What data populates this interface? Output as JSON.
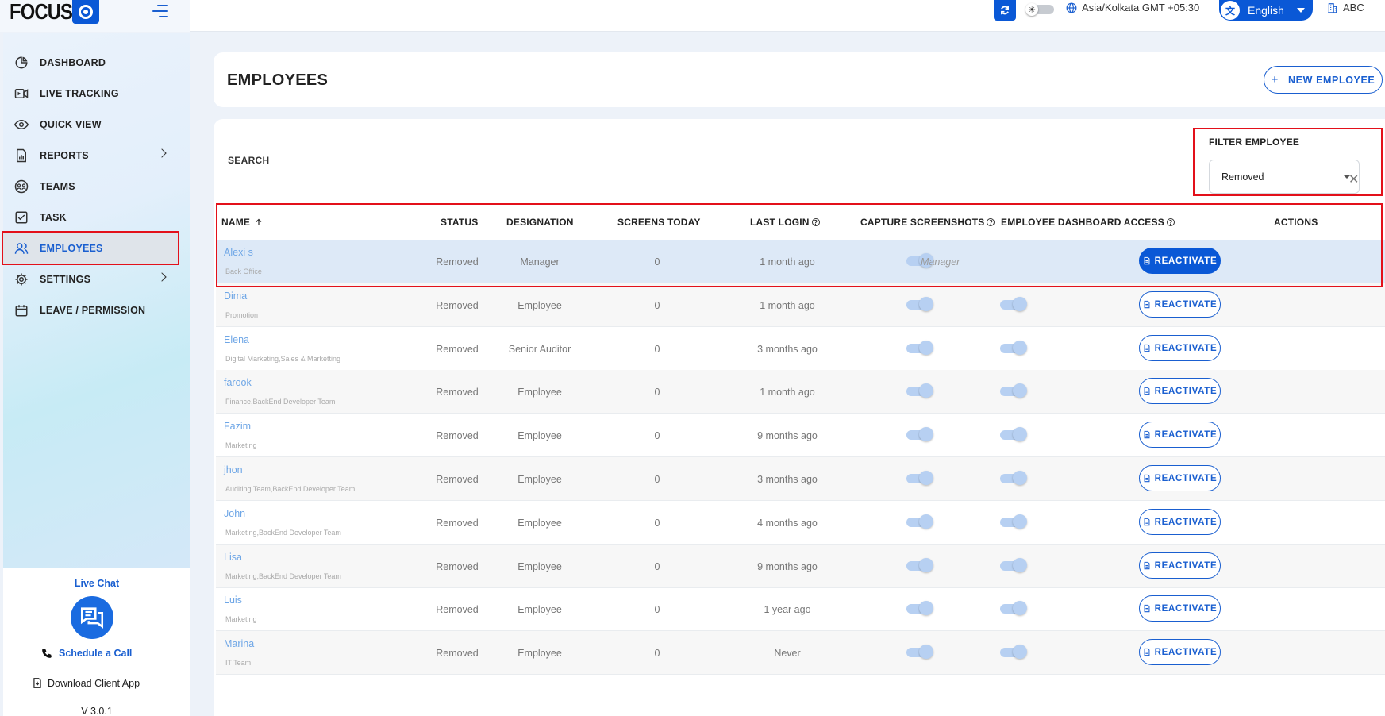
{
  "brand": {
    "logo_text": "FOCUS"
  },
  "topbar": {
    "timezone": "Asia/Kolkata GMT +05:30",
    "language": "English",
    "user": "ABC"
  },
  "sidebar": {
    "items": [
      {
        "label": "DASHBOARD",
        "icon": "pie-chart-icon"
      },
      {
        "label": "LIVE TRACKING",
        "icon": "video-icon"
      },
      {
        "label": "QUICK VIEW",
        "icon": "eye-icon"
      },
      {
        "label": "REPORTS",
        "icon": "report-icon",
        "expandable": true
      },
      {
        "label": "TEAMS",
        "icon": "team-icon"
      },
      {
        "label": "TASK",
        "icon": "task-icon"
      },
      {
        "label": "EMPLOYEES",
        "icon": "users-icon",
        "active": true
      },
      {
        "label": "SETTINGS",
        "icon": "gear-icon",
        "expandable": true
      },
      {
        "label": "LEAVE / PERMISSION",
        "icon": "calendar-icon"
      }
    ],
    "live_chat": "Live Chat",
    "schedule_call": "Schedule a Call",
    "download_app": "Download Client App",
    "version": "V 3.0.1"
  },
  "header": {
    "title": "EMPLOYEES",
    "new_button": "NEW EMPLOYEE"
  },
  "filters": {
    "search_label": "SEARCH",
    "filter_label": "FILTER EMPLOYEE",
    "filter_value": "Removed"
  },
  "table": {
    "columns": {
      "name": "NAME",
      "status": "STATUS",
      "designation": "DESIGNATION",
      "screens_today": "SCREENS TODAY",
      "last_login": "LAST LOGIN",
      "capture": "CAPTURE SCREENSHOTS",
      "dashboard_access": "EMPLOYEE DASHBOARD ACCESS",
      "actions": "ACTIONS"
    },
    "action_label": "REACTIVATE",
    "rows": [
      {
        "name": "Alexi s",
        "team": "Back Office",
        "status": "Removed",
        "designation": "Manager",
        "screens": "0",
        "last_login": "1 month ago",
        "access": "Manager"
      },
      {
        "name": "Dima",
        "team": "Promotion",
        "status": "Removed",
        "designation": "Employee",
        "screens": "0",
        "last_login": "1 month ago"
      },
      {
        "name": "Elena",
        "team": "Digital Marketing,Sales & Marketting",
        "status": "Removed",
        "designation": "Senior Auditor",
        "screens": "0",
        "last_login": "3 months ago"
      },
      {
        "name": "farook",
        "team": "Finance,BackEnd Developer Team",
        "status": "Removed",
        "designation": "Employee",
        "screens": "0",
        "last_login": "1 month ago"
      },
      {
        "name": "Fazim",
        "team": "Marketing",
        "status": "Removed",
        "designation": "Employee",
        "screens": "0",
        "last_login": "9 months ago"
      },
      {
        "name": "jhon",
        "team": "Auditing Team,BackEnd Developer Team",
        "status": "Removed",
        "designation": "Employee",
        "screens": "0",
        "last_login": "3 months ago"
      },
      {
        "name": "John",
        "team": "Marketing,BackEnd Developer Team",
        "status": "Removed",
        "designation": "Employee",
        "screens": "0",
        "last_login": "4 months ago"
      },
      {
        "name": "Lisa",
        "team": "Marketing,BackEnd Developer Team",
        "status": "Removed",
        "designation": "Employee",
        "screens": "0",
        "last_login": "9 months ago"
      },
      {
        "name": "Luis",
        "team": "Marketing",
        "status": "Removed",
        "designation": "Employee",
        "screens": "0",
        "last_login": "1 year ago"
      },
      {
        "name": "Marina",
        "team": "IT Team",
        "status": "Removed",
        "designation": "Employee",
        "screens": "0",
        "last_login": "Never"
      }
    ]
  }
}
